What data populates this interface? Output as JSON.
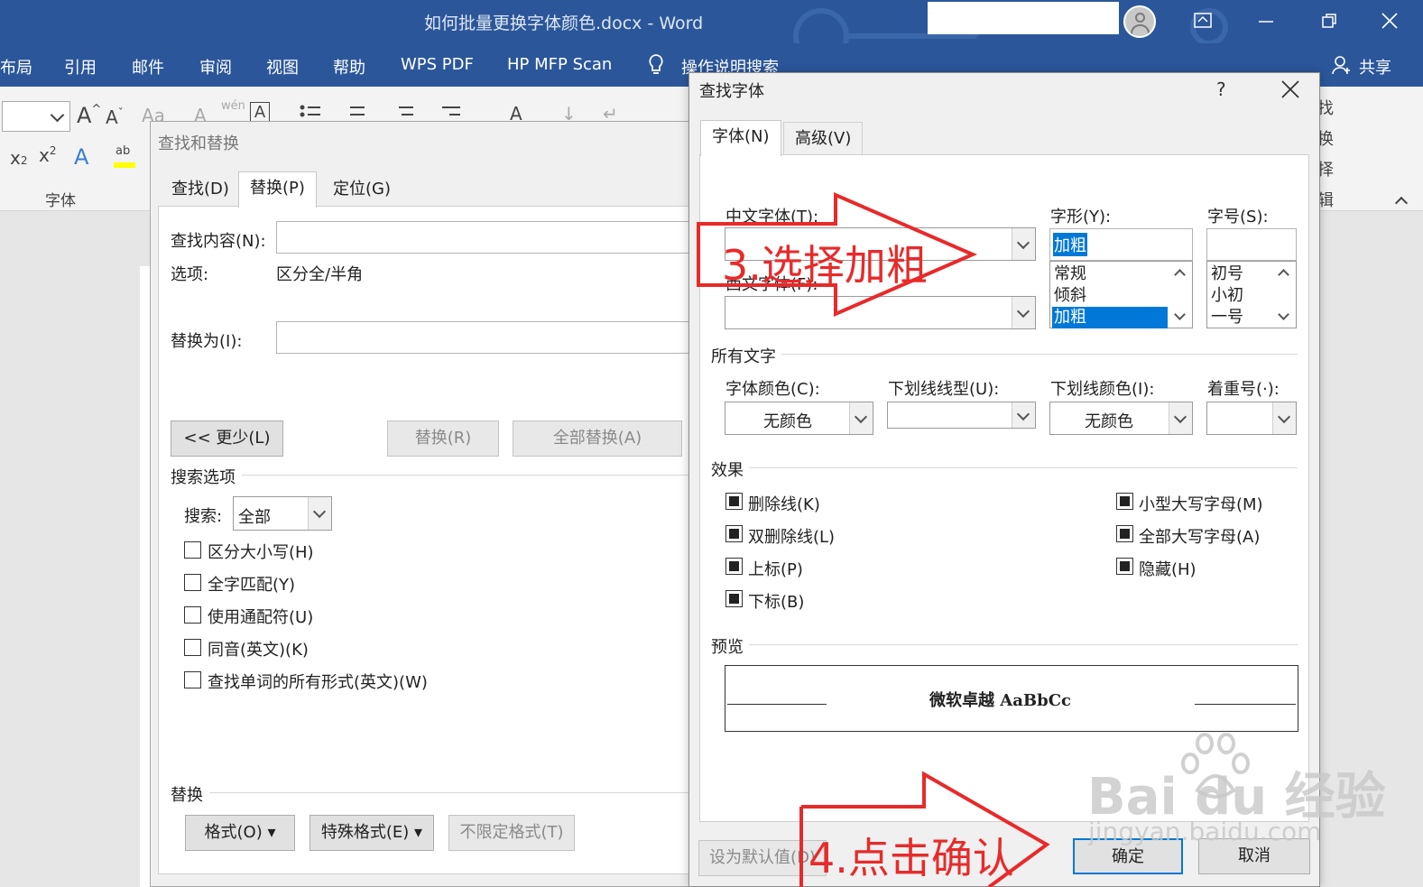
{
  "window": {
    "title": "如何批量更换字体颜色.docx  -  Word",
    "controls": [
      "ribbon-display-icon",
      "minimize-icon",
      "restore-icon",
      "close-icon"
    ]
  },
  "menu": {
    "items": [
      "布局",
      "引用",
      "邮件",
      "审阅",
      "视图",
      "帮助",
      "WPS PDF",
      "HP MFP Scan"
    ],
    "tell_me": "操作说明搜索",
    "share": "共享"
  },
  "ribbon": {
    "font_group_label": "字体",
    "right_column": [
      "找",
      "换",
      "择",
      "辑"
    ]
  },
  "find_replace": {
    "title": "查找和替换",
    "tabs": [
      "查找(D)",
      "替换(P)",
      "定位(G)"
    ],
    "active_tab": 1,
    "find_label": "查找内容(N):",
    "options_label": "选项:",
    "options_value": "区分全/半角",
    "replace_label": "替换为(I):",
    "less_button": "<< 更少(L)",
    "replace_button": "替换(R)",
    "replace_all_button": "全部替换(A)",
    "search_options_title": "搜索选项",
    "search_label": "搜索:",
    "search_value": "全部",
    "checkboxes": [
      "区分大小写(H)",
      "全字匹配(Y)",
      "使用通配符(U)",
      "同音(英文)(K)",
      "查找单词的所有形式(英文)(W)"
    ],
    "replace_section_title": "替换",
    "format_button": "格式(O)",
    "special_button": "特殊格式(E)",
    "no_format_button": "不限定格式(T)"
  },
  "find_font": {
    "title": "查找字体",
    "help": "?",
    "tabs": [
      "字体(N)",
      "高级(V)"
    ],
    "active_tab": 0,
    "cn_font_label": "中文字体(T):",
    "west_font_label": "西文字体(F):",
    "style_label": "字形(Y):",
    "style_value": "加粗",
    "style_options": [
      "常规",
      "倾斜",
      "加粗"
    ],
    "style_selected": 2,
    "size_label": "字号(S):",
    "size_options": [
      "初号",
      "小初",
      "一号"
    ],
    "all_text_title": "所有文字",
    "font_color_label": "字体颜色(C):",
    "font_color_value": "无颜色",
    "underline_type_label": "下划线线型(U):",
    "underline_color_label": "下划线颜色(I):",
    "underline_color_value": "无颜色",
    "emphasis_label": "着重号(·):",
    "effects_title": "效果",
    "effects_left": [
      "删除线(K)",
      "双删除线(L)",
      "上标(P)",
      "下标(B)"
    ],
    "effects_right": [
      "小型大写字母(M)",
      "全部大写字母(A)",
      "隐藏(H)"
    ],
    "preview_title": "预览",
    "preview_text": "微软卓越    AaBbCc",
    "set_default_button": "设为默认值(D)",
    "ok_button": "确定",
    "cancel_button": "取消"
  },
  "annotations": {
    "step3": "3.选择加粗",
    "step4": "4.点击确认",
    "color": "#e82a2a"
  },
  "watermark": {
    "logo": "Bai du 经验",
    "url": "jingyan.baidu.com"
  },
  "colors": {
    "title_bar": "#2b579a",
    "selection": "#0078d7",
    "annotation": "#e82a2a"
  }
}
